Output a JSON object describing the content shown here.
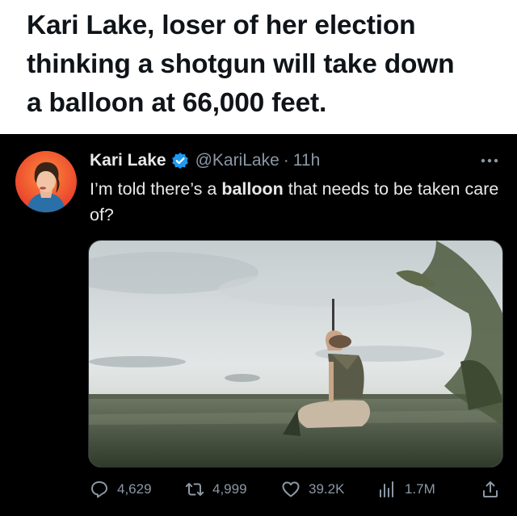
{
  "caption": {
    "line1": "Kari Lake, loser of her election",
    "line2": "thinking a shotgun will take down",
    "line3": "a balloon at 66,000 feet."
  },
  "tweet": {
    "author_name": "Kari Lake",
    "author_handle": "@KariLake",
    "separator": "·",
    "time_ago": "11h",
    "text_before": "I’m told there’s a ",
    "text_bold": "balloon",
    "text_after": " that needs to be taken care of?",
    "stats": {
      "replies": "4,629",
      "retweets": "4,999",
      "likes": "39.2K",
      "views": "1.7M"
    }
  },
  "icons": {
    "verified": "verified-badge-icon",
    "more": "more-options-icon",
    "reply": "reply-icon",
    "retweet": "retweet-icon",
    "like": "heart-icon",
    "views": "analytics-icon",
    "share": "share-icon"
  },
  "colors": {
    "caption_bg": "#ffffff",
    "tweet_bg": "#000000",
    "verified": "#1d9bf0",
    "secondary_text": "#8b98a5",
    "primary_text": "#e7e9ea"
  }
}
